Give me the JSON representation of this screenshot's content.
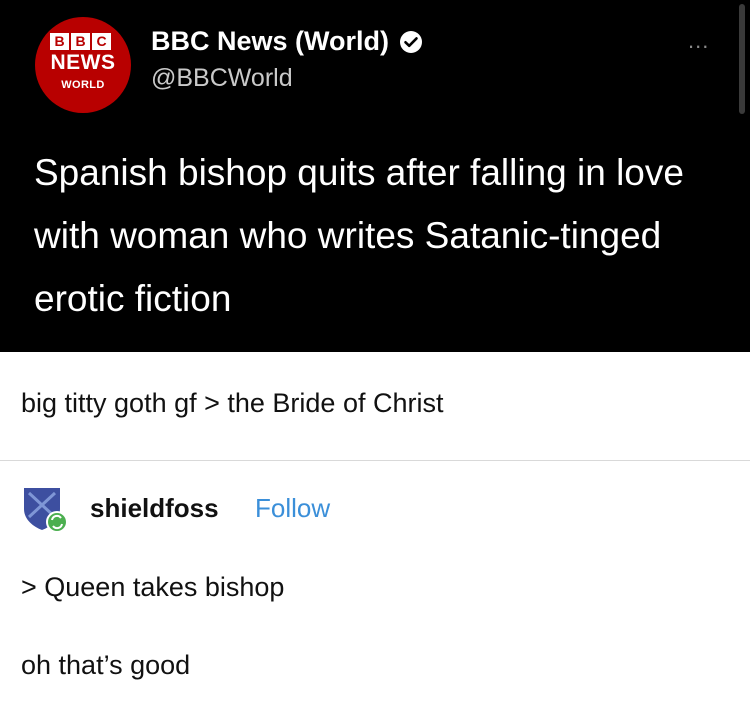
{
  "tweet": {
    "logo": {
      "letters": [
        "B",
        "B",
        "C"
      ],
      "news": "NEWS",
      "world": "WORLD"
    },
    "author_name": "BBC News (World)",
    "author_handle": "@BBCWorld",
    "more_label": "...",
    "text": "Spanish bishop quits after falling in love with woman who writes Satanic-tinged erotic fiction",
    "colors": {
      "background": "#000000",
      "logo_red": "#b80000"
    }
  },
  "post": {
    "comment": "big titty goth gf > the Bride of Christ"
  },
  "reblog": {
    "username": "shieldfoss",
    "follow_label": "Follow",
    "lines": [
      "> Queen takes bishop",
      "oh that’s good"
    ],
    "colors": {
      "follow": "#3b8fd9",
      "avatar_blue": "#3d4fa0",
      "reblog_badge": "#4caf50"
    }
  }
}
